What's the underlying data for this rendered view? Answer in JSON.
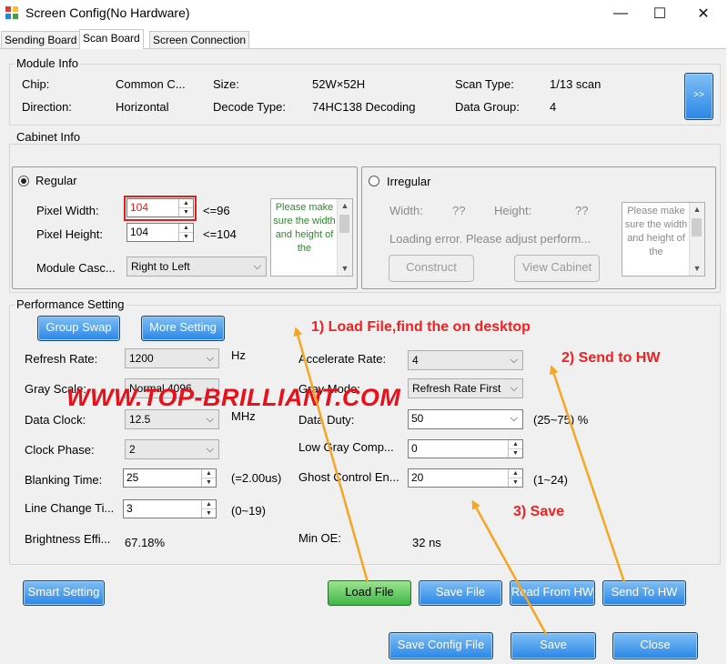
{
  "window": {
    "title": "Screen Config(No Hardware)",
    "min_glyph": "—",
    "max_glyph": "☐",
    "close_glyph": "✕"
  },
  "tabs": [
    {
      "label": "Sending Board",
      "active": false
    },
    {
      "label": "Scan Board",
      "active": true
    },
    {
      "label": "Screen Connection",
      "active": false
    }
  ],
  "module_info": {
    "title": "Module Info",
    "chip_label": "Chip:",
    "chip_value": "Common C...",
    "size_label": "Size:",
    "size_value": "52W×52H",
    "scan_type_label": "Scan Type:",
    "scan_type_value": "1/13 scan",
    "direction_label": "Direction:",
    "direction_value": "Horizontal",
    "decode_type_label": "Decode Type:",
    "decode_type_value": "74HC138 Decoding",
    "data_group_label": "Data Group:",
    "data_group_value": "4",
    "expand_label": ">>"
  },
  "cabinet_info": {
    "title": "Cabinet Info",
    "regular": {
      "label": "Regular",
      "selected": true,
      "pixel_width_label": "Pixel Width:",
      "pixel_width_value": "104",
      "pixel_width_limit": "<=96",
      "pixel_height_label": "Pixel Height:",
      "pixel_height_value": "104",
      "pixel_height_limit": "<=104",
      "module_cascade_label": "Module Casc...",
      "module_cascade_value": "Right to Left",
      "note": "Please make sure the width and height of the"
    },
    "irregular": {
      "label": "Irregular",
      "selected": false,
      "width_label": "Width:",
      "width_value": "??",
      "height_label": "Height:",
      "height_value": "??",
      "error_text": "Loading error. Please adjust perform...",
      "construct_label": "Construct",
      "view_cabinet_label": "View Cabinet",
      "note": "Please make sure the width and height of the"
    }
  },
  "performance": {
    "title": "Performance Setting",
    "group_swap_label": "Group Swap",
    "more_setting_label": "More Setting",
    "refresh_rate_label": "Refresh Rate:",
    "refresh_rate_value": "1200",
    "refresh_rate_unit": "Hz",
    "gray_scale_label": "Gray Scale:",
    "gray_scale_value": "Normal 4096",
    "data_clock_label": "Data Clock:",
    "data_clock_value": "12.5",
    "data_clock_unit": "MHz",
    "clock_phase_label": "Clock Phase:",
    "clock_phase_value": "2",
    "blanking_time_label": "Blanking Time:",
    "blanking_time_value": "25",
    "blanking_time_note": "(=2.00us)",
    "line_change_label": "Line Change Ti...",
    "line_change_value": "3",
    "line_change_range": "(0~19)",
    "brightness_label": "Brightness Effi...",
    "brightness_value": "67.18%",
    "accelerate_rate_label": "Accelerate Rate:",
    "accelerate_rate_value": "4",
    "gray_mode_label": "Gray Mode:",
    "gray_mode_value": "Refresh Rate First",
    "data_duty_label": "Data Duty:",
    "data_duty_value": "50",
    "data_duty_range": "(25~75) %",
    "low_gray_label": "Low Gray Comp...",
    "low_gray_value": "0",
    "ghost_control_label": "Ghost Control En...",
    "ghost_control_value": "20",
    "ghost_control_range": "(1~24)",
    "min_oe_label": "Min OE:",
    "min_oe_value": "32 ns"
  },
  "action_buttons": {
    "smart_setting": "Smart Setting",
    "load_file": "Load File",
    "save_file": "Save File",
    "read_from_hw": "Read From HW",
    "send_to_hw": "Send To HW"
  },
  "footer_buttons": {
    "save_config_file": "Save Config File",
    "save": "Save",
    "close": "Close"
  },
  "annotations": {
    "load_file": "1) Load File,find the on desktop",
    "send_to_hw": "2) Send to HW",
    "save": "3) Save",
    "watermark": "WWW.TOP-BRILLIANT.COM",
    "arrow_color": "#f5a623",
    "text_color": "#ee2222"
  }
}
